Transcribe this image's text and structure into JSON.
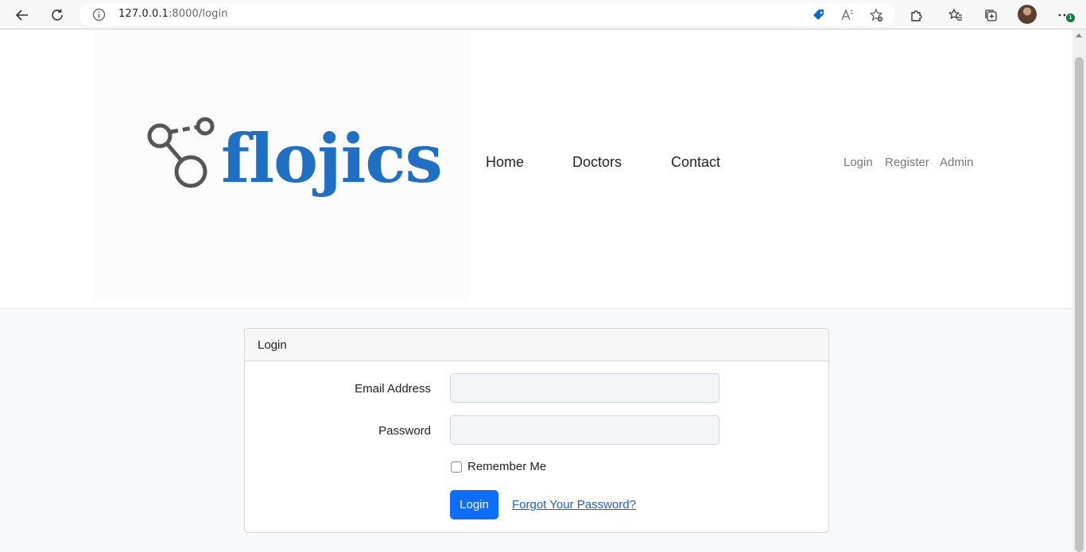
{
  "browser": {
    "url_host": "127.0.0.1",
    "url_path": ":8000/login",
    "extension_badge": "1"
  },
  "header": {
    "logo_text": "flojics",
    "nav": [
      "Home",
      "Doctors",
      "Contact"
    ],
    "auth": [
      "Login",
      "Register",
      "Admin"
    ]
  },
  "login_card": {
    "title": "Login",
    "email_label": "Email Address",
    "email_value": "",
    "password_label": "Password",
    "password_value": "",
    "remember_label": "Remember Me",
    "submit_label": "Login",
    "forgot_label": "Forgot Your Password?"
  },
  "colors": {
    "brand_blue": "#1f6fc5",
    "primary_button": "#0d6efd",
    "logo_icon_gray": "#555555"
  },
  "icons": [
    "back-arrow-icon",
    "refresh-icon",
    "info-icon",
    "tag-icon",
    "read-aloud-icon",
    "favorite-add-icon",
    "extensions-icon",
    "favorites-icon",
    "collections-icon",
    "more-icon",
    "molecule-logo-icon"
  ]
}
